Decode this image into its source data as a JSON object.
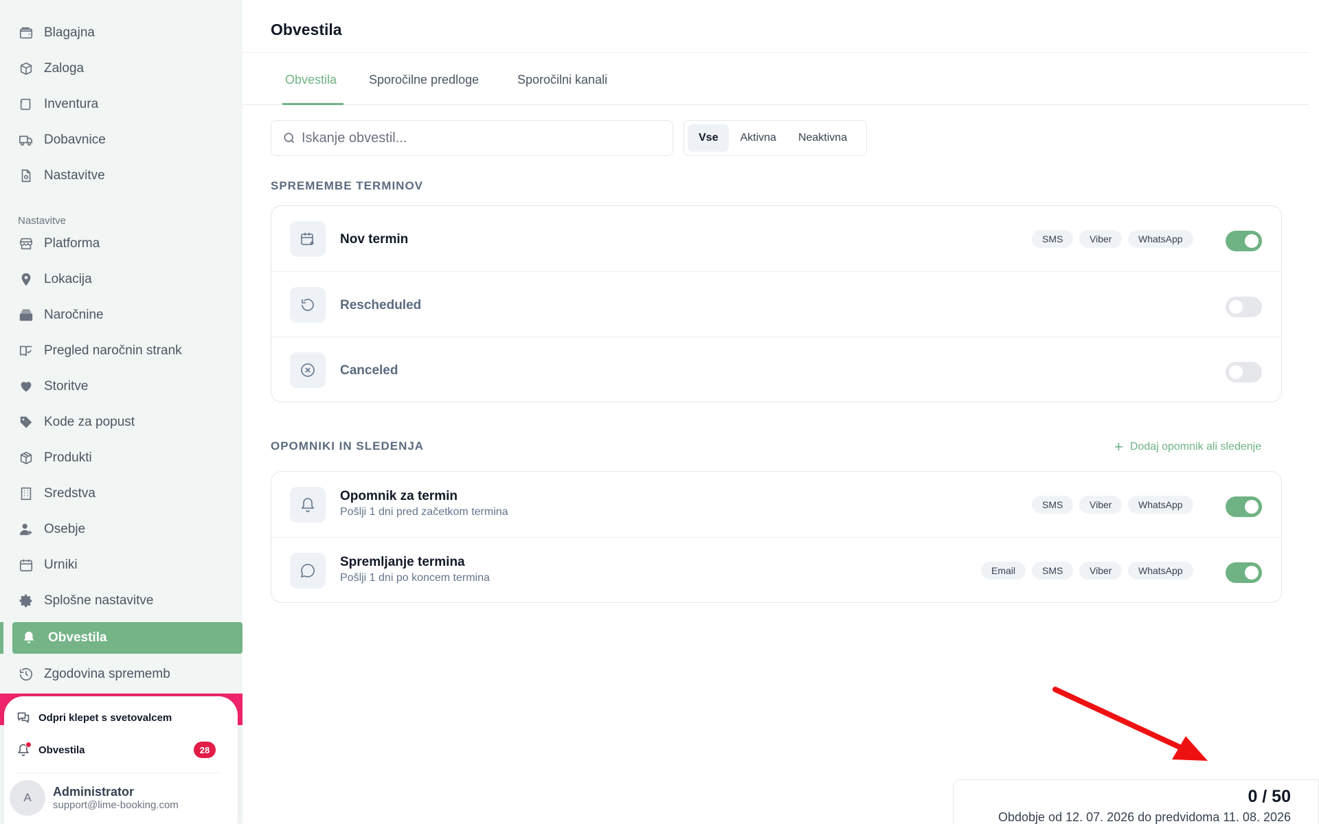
{
  "sidebar": {
    "items_top": [
      {
        "label": "Blagajna",
        "icon": "wallet-icon"
      },
      {
        "label": "Zaloga",
        "icon": "boxes-icon"
      },
      {
        "label": "Inventura",
        "icon": "scroll-icon"
      },
      {
        "label": "Dobavnice",
        "icon": "truck-icon"
      },
      {
        "label": "Nastavitve",
        "icon": "file-gear-icon"
      }
    ],
    "section_label": "Nastavitve",
    "items_settings": [
      {
        "label": "Platforma",
        "icon": "store-icon"
      },
      {
        "label": "Lokacija",
        "icon": "map-pin-icon"
      },
      {
        "label": "Naročnine",
        "icon": "subscription-icon"
      },
      {
        "label": "Pregled naročnin strank",
        "icon": "book-check-icon"
      },
      {
        "label": "Storitve",
        "icon": "heart-hand-icon"
      },
      {
        "label": "Kode za popust",
        "icon": "tag-icon"
      },
      {
        "label": "Produkti",
        "icon": "package-icon"
      },
      {
        "label": "Sredstva",
        "icon": "building-icon"
      },
      {
        "label": "Osebje",
        "icon": "user-plus-icon"
      },
      {
        "label": "Urniki",
        "icon": "calendar-icon"
      },
      {
        "label": "Splošne nastavitve",
        "icon": "gear-icon"
      },
      {
        "label": "Obvestila",
        "icon": "bell-icon",
        "active": true
      },
      {
        "label": "Zgodovina sprememb",
        "icon": "history-icon"
      }
    ],
    "bottom": {
      "chat_label": "Odpri klepet s svetovalcem",
      "notifications_label": "Obvestila",
      "notifications_count": "28",
      "avatar_initial": "A",
      "user_name": "Administrator",
      "user_email": "support@lime-booking.com"
    }
  },
  "main": {
    "title": "Obvestila",
    "tabs": [
      "Obvestila",
      "Sporočilne predloge",
      "Sporočilni kanali"
    ],
    "active_tab": "Obvestila",
    "search_placeholder": "Iskanje obvestil...",
    "filters": [
      "Vse",
      "Aktivna",
      "Neaktivna"
    ],
    "selected_filter": "Vse",
    "section1_title": "SPREMEMBE TERMINOV",
    "section1_rows": [
      {
        "title": "Nov termin",
        "icon": "calendar-plus-icon",
        "channels": [
          "SMS",
          "Viber",
          "WhatsApp"
        ],
        "enabled": true
      },
      {
        "title": "Rescheduled",
        "icon": "rotate-ccw-icon",
        "channels": [],
        "enabled": false
      },
      {
        "title": "Canceled",
        "icon": "x-circle-icon",
        "channels": [],
        "enabled": false
      }
    ],
    "section2_title": "OPOMNIKI IN SLEDENJA",
    "add_label": "Dodaj opomnik ali sledenje",
    "section2_rows": [
      {
        "title": "Opomnik za termin",
        "subtitle": "Pošlji 1 dni pred začetkom termina",
        "icon": "bell-icon",
        "channels": [
          "SMS",
          "Viber",
          "WhatsApp"
        ],
        "enabled": true
      },
      {
        "title": "Spremljanje termina",
        "subtitle": "Pošlji 1 dni po koncem termina",
        "icon": "chat-bubble-icon",
        "channels": [
          "Email",
          "SMS",
          "Viber",
          "WhatsApp"
        ],
        "enabled": true
      }
    ]
  },
  "usage": {
    "count": "0 / 50",
    "period": "Obdobje od 12. 07. 2026 do predvidoma 11. 08. 2026"
  },
  "colors": {
    "accent": "#6fb283",
    "active_nav": "#74b487",
    "alert": "#e11d48",
    "strip": "#f0246b",
    "arrow": "#ee1111"
  }
}
